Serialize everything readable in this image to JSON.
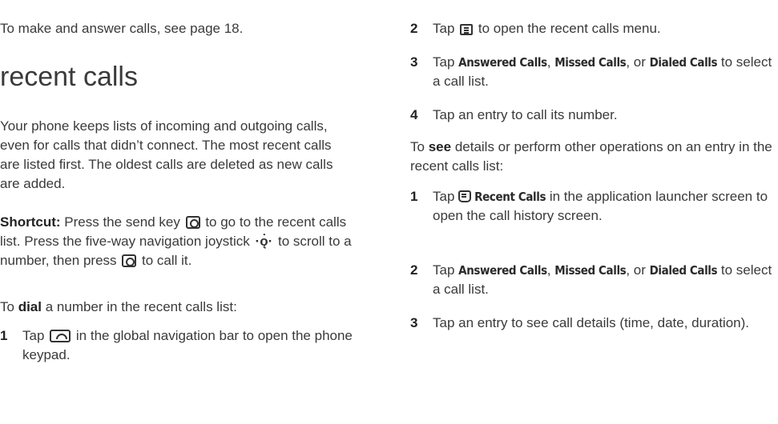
{
  "left": {
    "intro": "To make and answer calls, see page 18.",
    "heading": "recent calls",
    "para1": "Your phone keeps lists of incoming and outgoing calls, even for calls that didn’t connect. The most recent calls are listed first. The oldest calls are deleted as new calls are added.",
    "shortcut": {
      "label": "Shortcut:",
      "t1": "Press the send key",
      "t2": "to go to the recent calls list. Press the five-way navigation joystick",
      "t3": "to scroll to a number, then press",
      "t4": "to call it."
    },
    "dial": {
      "pre": "To",
      "bold": "dial",
      "post": "a number in the recent calls list:"
    },
    "step1": {
      "num": "1",
      "pre": "Tap",
      "post": "in the global navigation bar to open the phone keypad."
    }
  },
  "right": {
    "step2": {
      "num": "2",
      "pre": "Tap",
      "post": "to open the recent calls menu."
    },
    "step3": {
      "num": "3",
      "pre": "Tap",
      "ui1": "Answered Calls",
      "sep1": ",",
      "ui2": "Missed Calls",
      "sep2": ", or",
      "ui3": "Dialed Calls",
      "post": "to select a call list."
    },
    "step4": {
      "num": "4",
      "text": "Tap an entry to call its number."
    },
    "see": {
      "pre": "To",
      "bold": "see",
      "post": "details or perform other operations on an entry in the recent calls list:"
    },
    "s1": {
      "num": "1",
      "pre": "Tap",
      "ui": "Recent Calls",
      "post": "in the application launcher screen to open the call history screen."
    },
    "s2": {
      "num": "2",
      "pre": "Tap",
      "ui1": "Answered Calls",
      "sep1": ",",
      "ui2": "Missed Calls",
      "sep2": ", or",
      "ui3": "Dialed Calls",
      "post": "to select a call list."
    },
    "s3": {
      "num": "3",
      "text": "Tap an entry to see call details (time, date, duration)."
    }
  }
}
